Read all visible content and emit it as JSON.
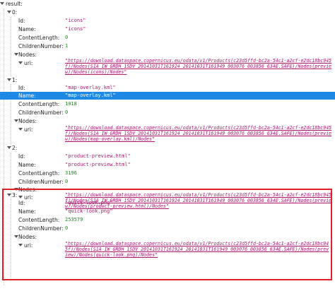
{
  "root_label": "result:",
  "items": [
    {
      "index": "0:",
      "id_label": "Id:",
      "id": "\"icons\"",
      "name_label": "Name:",
      "name": "\"icons\"",
      "cl_label": "ContentLength:",
      "cl": "0",
      "cn_label": "ChildrenNumber:",
      "cn": "1",
      "nodes_label": "Nodes:",
      "uri_label": "uri:",
      "uri": "\"https://download.dataspace.copernicus.eu/odata/v1/Products(c23d5ffd-bc2a-54c1-a2cf-e2dc18bc945f)/Nodes(S1A_IW_GRDH_1SDV_20141031T161924_20141031T161949_003076_003856_634E.SAFE)/Nodes(preview)/Nodes(icons)/Nodes\""
    },
    {
      "index": "1:",
      "id_label": "Id:",
      "id": "\"map-overlay.kml\"",
      "name_label": "Name:",
      "name": "\"map-overlay.kml\"",
      "cl_label": "ContentLength:",
      "cl": "1018",
      "cn_label": "ChildrenNumber:",
      "cn": "0",
      "nodes_label": "Nodes:",
      "uri_label": "uri:",
      "uri": "\"https://download.dataspace.copernicus.eu/odata/v1/Products(c23d5ffd-bc2a-54c1-a2cf-e2dc18bc945f)/Nodes(S1A_IW_GRDH_1SDV_20141031T161924_20141031T161949_003076_003856_634E.SAFE)/Nodes(preview)/Nodes(map-overlay.kml)/Nodes\""
    },
    {
      "index": "2:",
      "id_label": "Id:",
      "id": "\"product-preview.html\"",
      "name_label": "Name:",
      "name": "\"product-preview.html\"",
      "cl_label": "ContentLength:",
      "cl": "3196",
      "cn_label": "ChildrenNumber:",
      "cn": "0",
      "nodes_label": "Nodes:",
      "uri_label": "uri:",
      "uri": "\"https://download.dataspace.copernicus.eu/odata/v1/Products(c23d5ffd-bc2a-54c1-a2cf-e2dc18bc945f)/Nodes(S1A_IW_GRDH_1SDV_20141031T161924_20141031T161949_003076_003856_634E.SAFE)/Nodes(preview)/Nodes(product-preview.html)/Nodes\""
    },
    {
      "index": "3:",
      "id_label": "Id:",
      "id": "\"quick-look.png\"",
      "name_label": "Name:",
      "name": "\"quick-look.png\"",
      "cl_label": "ContentLength:",
      "cl": "253579",
      "cn_label": "ChildrenNumber:",
      "cn": "0",
      "nodes_label": "Nodes:",
      "uri_label": "uri:",
      "uri": "\"https://download.dataspace.copernicus.eu/odata/v1/Products(c23d5ffd-bc2a-54c1-a2cf-e2dc18bc945f)/Nodes(S1A_IW_GRDH_1SDV_20141031T161924_20141031T161949_003076_003856_634E.SAFE)/Nodes(preview)/Nodes(quick-look.png)/Nodes\""
    }
  ],
  "colors": {
    "selection": "#1e88e5",
    "highlight_border": "#e0202a",
    "string": "#b01570",
    "number": "#1a8a1a"
  }
}
